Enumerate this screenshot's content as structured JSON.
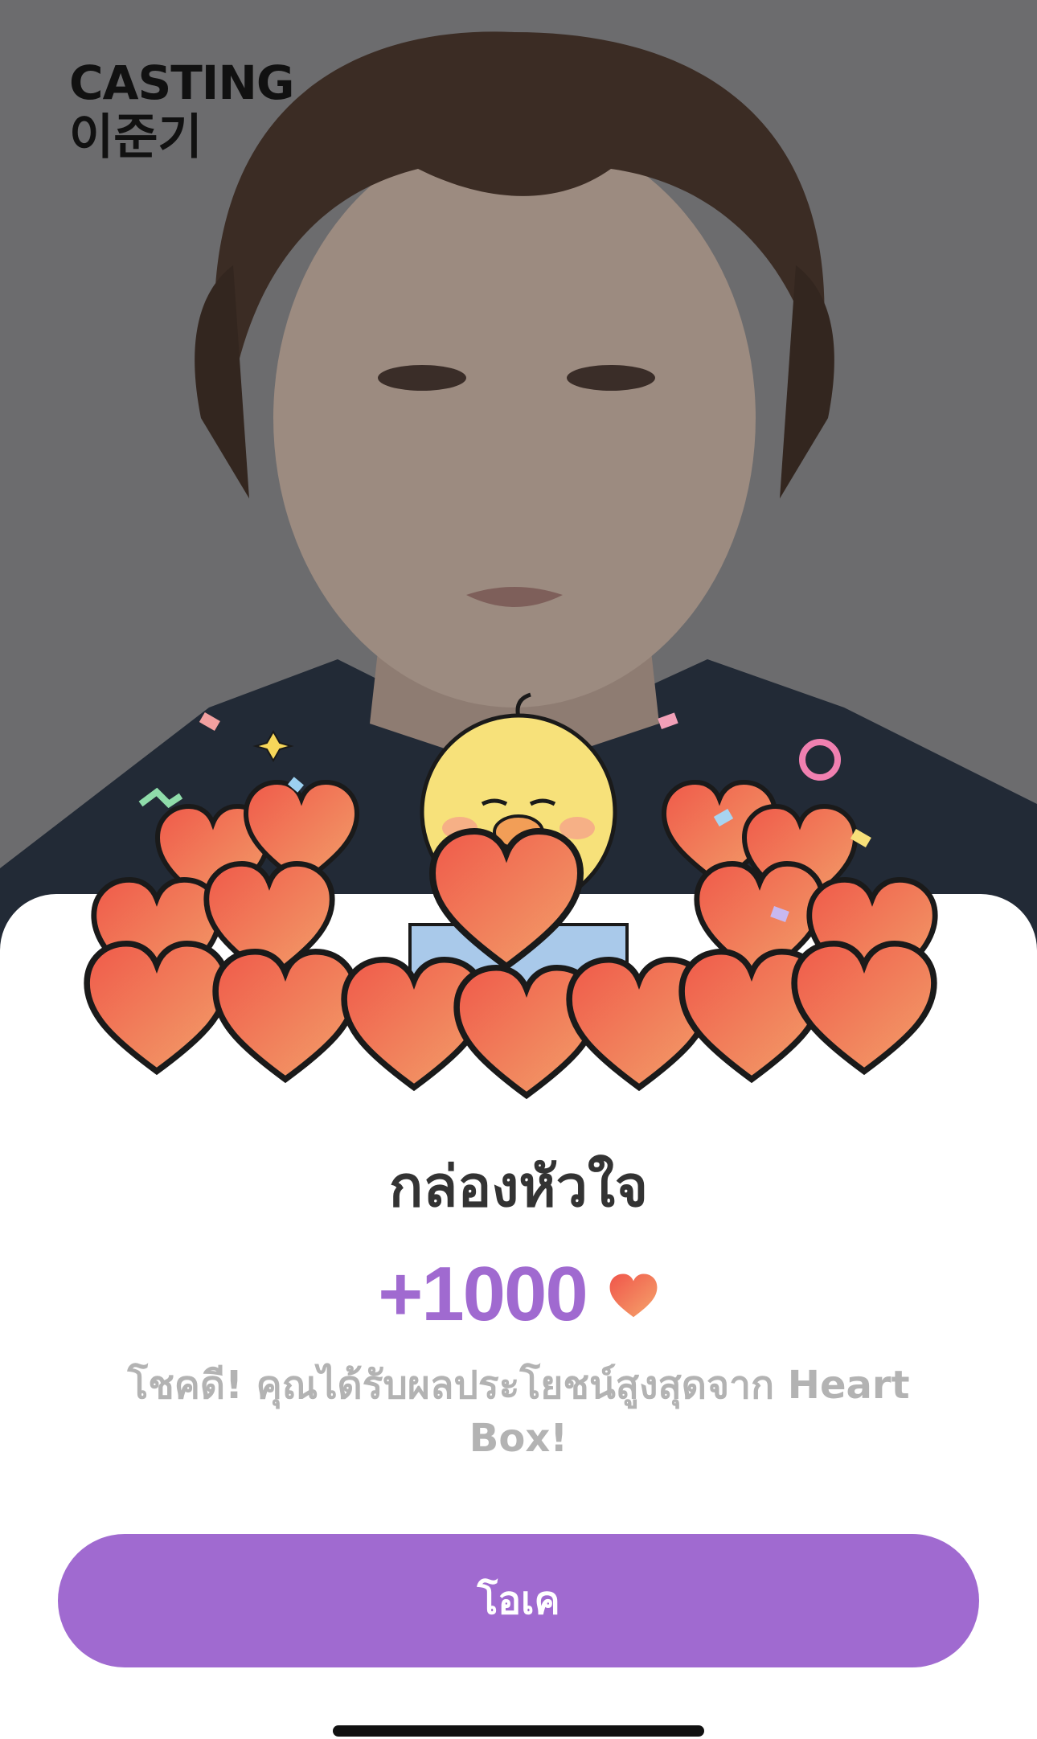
{
  "brand": {
    "line1": "CASTING",
    "line2": "이준기"
  },
  "dialog": {
    "title": "กล่องหัวใจ",
    "reward_amount": "+1000",
    "reward_icon": "heart-icon",
    "description": "โชคดี! คุณได้รับผลประโยชน์สูงสุดจาก Heart Box!",
    "ok_label": "โอเค"
  },
  "colors": {
    "accent": "#a06ad0",
    "title": "#333333",
    "description": "#b3b3b3",
    "heart": "#f06a4d"
  }
}
